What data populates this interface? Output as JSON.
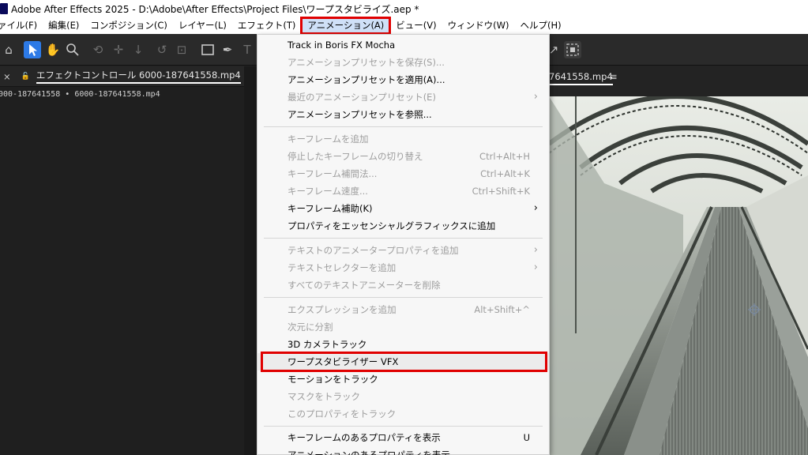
{
  "title": "Adobe After Effects 2025 - D:\\Adobe\\After Effects\\Project Files\\ワープスタビライズ.aep *",
  "menubar": [
    "ァイル(F)",
    "編集(E)",
    "コンポジション(C)",
    "レイヤー(L)",
    "エフェクト(T)",
    "アニメーション(A)",
    "ビュー(V)",
    "ウィンドウ(W)",
    "ヘルプ(H)"
  ],
  "active_menu_index": 5,
  "accent_color": "#2d7ae6",
  "highlight_color": "#e00000",
  "left_panel": {
    "tab_label": "エフェクトコントロール 6000-187641558.mp4",
    "menu_icon": "≡",
    "overflow_icon": "»",
    "breadcrumb": "000-187641558 • 6000-187641558.mp4"
  },
  "viewer": {
    "tab_label": "7641558.mp4",
    "menu_icon": "≡"
  },
  "dropdown": {
    "items": [
      {
        "label": "Track in Boris FX Mocha",
        "shortcut": "",
        "submenu": false,
        "disabled": false
      },
      {
        "label": "アニメーションプリセットを保存(S)...",
        "shortcut": "",
        "submenu": false,
        "disabled": true
      },
      {
        "label": "アニメーションプリセットを適用(A)...",
        "shortcut": "",
        "submenu": false,
        "disabled": false
      },
      {
        "label": "最近のアニメーションプリセット(E)",
        "shortcut": "",
        "submenu": true,
        "disabled": true
      },
      {
        "label": "アニメーションプリセットを参照...",
        "shortcut": "",
        "submenu": false,
        "disabled": false
      },
      {
        "label": "キーフレームを追加",
        "shortcut": "",
        "submenu": false,
        "disabled": true
      },
      {
        "label": "停止したキーフレームの切り替え",
        "shortcut": "Ctrl+Alt+H",
        "submenu": false,
        "disabled": true
      },
      {
        "label": "キーフレーム補間法...",
        "shortcut": "Ctrl+Alt+K",
        "submenu": false,
        "disabled": true
      },
      {
        "label": "キーフレーム速度...",
        "shortcut": "Ctrl+Shift+K",
        "submenu": false,
        "disabled": true
      },
      {
        "label": "キーフレーム補助(K)",
        "shortcut": "",
        "submenu": true,
        "disabled": false
      },
      {
        "label": "プロパティをエッセンシャルグラフィックスに追加",
        "shortcut": "",
        "submenu": false,
        "disabled": false
      },
      {
        "label": "テキストのアニメータープロパティを追加",
        "shortcut": "",
        "submenu": true,
        "disabled": true
      },
      {
        "label": "テキストセレクターを追加",
        "shortcut": "",
        "submenu": true,
        "disabled": true
      },
      {
        "label": "すべてのテキストアニメーターを削除",
        "shortcut": "",
        "submenu": false,
        "disabled": true
      },
      {
        "label": "エクスプレッションを追加",
        "shortcut": "Alt+Shift+^",
        "submenu": false,
        "disabled": true
      },
      {
        "label": "次元に分割",
        "shortcut": "",
        "submenu": false,
        "disabled": true
      },
      {
        "label": "3D カメラトラック",
        "shortcut": "",
        "submenu": false,
        "disabled": false
      },
      {
        "label": "ワープスタビライザー VFX",
        "shortcut": "",
        "submenu": false,
        "disabled": false,
        "highlighted": true
      },
      {
        "label": "モーションをトラック",
        "shortcut": "",
        "submenu": false,
        "disabled": false
      },
      {
        "label": "マスクをトラック",
        "shortcut": "",
        "submenu": false,
        "disabled": true
      },
      {
        "label": "このプロパティをトラック",
        "shortcut": "",
        "submenu": false,
        "disabled": true
      },
      {
        "label": "キーフレームのあるプロパティを表示",
        "shortcut": "U",
        "submenu": false,
        "disabled": false
      },
      {
        "label": "アニメーションのあるプロパティを表示",
        "shortcut": "",
        "submenu": false,
        "disabled": false
      }
    ],
    "submenu_arrow": "›"
  },
  "toolbar_icons": [
    "home-icon",
    "selection-tool-icon",
    "hand-tool-icon",
    "zoom-tool-icon",
    "orbit-camera-icon",
    "pan-camera-icon",
    "dolly-camera-icon",
    "rotation-tool-icon",
    "pan-behind-tool-icon",
    "rectangle-tool-icon",
    "pen-tool-icon",
    "type-tool-icon",
    "pin-tool-icon",
    "snapping-icon"
  ]
}
